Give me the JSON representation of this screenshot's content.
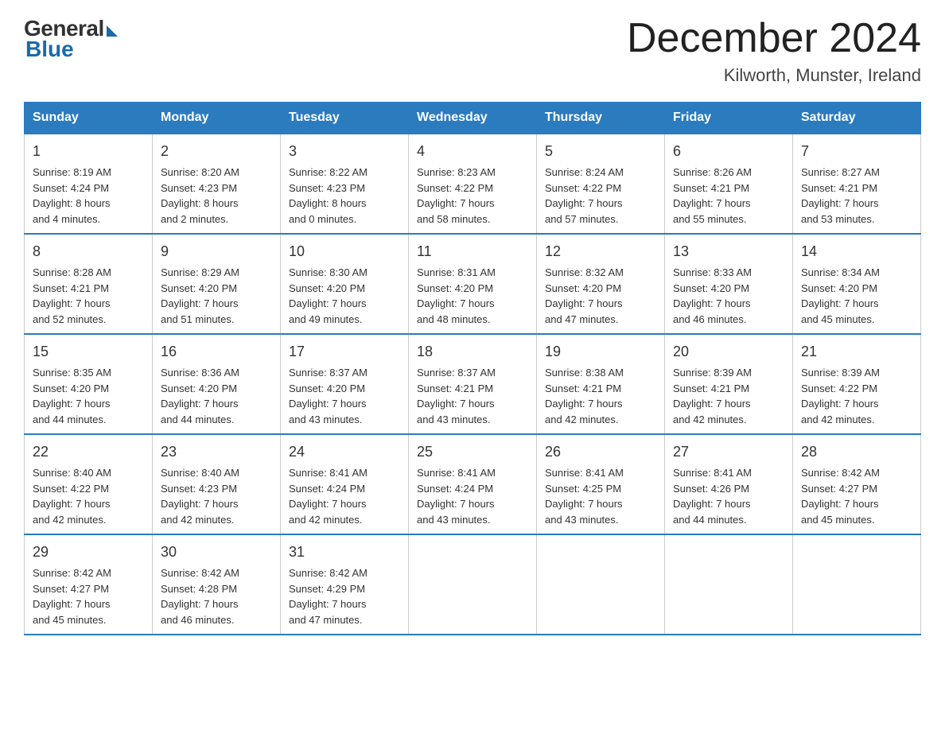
{
  "logo": {
    "general": "General",
    "blue": "Blue"
  },
  "header": {
    "month": "December 2024",
    "location": "Kilworth, Munster, Ireland"
  },
  "weekdays": [
    "Sunday",
    "Monday",
    "Tuesday",
    "Wednesday",
    "Thursday",
    "Friday",
    "Saturday"
  ],
  "weeks": [
    [
      {
        "day": "1",
        "info": "Sunrise: 8:19 AM\nSunset: 4:24 PM\nDaylight: 8 hours\nand 4 minutes."
      },
      {
        "day": "2",
        "info": "Sunrise: 8:20 AM\nSunset: 4:23 PM\nDaylight: 8 hours\nand 2 minutes."
      },
      {
        "day": "3",
        "info": "Sunrise: 8:22 AM\nSunset: 4:23 PM\nDaylight: 8 hours\nand 0 minutes."
      },
      {
        "day": "4",
        "info": "Sunrise: 8:23 AM\nSunset: 4:22 PM\nDaylight: 7 hours\nand 58 minutes."
      },
      {
        "day": "5",
        "info": "Sunrise: 8:24 AM\nSunset: 4:22 PM\nDaylight: 7 hours\nand 57 minutes."
      },
      {
        "day": "6",
        "info": "Sunrise: 8:26 AM\nSunset: 4:21 PM\nDaylight: 7 hours\nand 55 minutes."
      },
      {
        "day": "7",
        "info": "Sunrise: 8:27 AM\nSunset: 4:21 PM\nDaylight: 7 hours\nand 53 minutes."
      }
    ],
    [
      {
        "day": "8",
        "info": "Sunrise: 8:28 AM\nSunset: 4:21 PM\nDaylight: 7 hours\nand 52 minutes."
      },
      {
        "day": "9",
        "info": "Sunrise: 8:29 AM\nSunset: 4:20 PM\nDaylight: 7 hours\nand 51 minutes."
      },
      {
        "day": "10",
        "info": "Sunrise: 8:30 AM\nSunset: 4:20 PM\nDaylight: 7 hours\nand 49 minutes."
      },
      {
        "day": "11",
        "info": "Sunrise: 8:31 AM\nSunset: 4:20 PM\nDaylight: 7 hours\nand 48 minutes."
      },
      {
        "day": "12",
        "info": "Sunrise: 8:32 AM\nSunset: 4:20 PM\nDaylight: 7 hours\nand 47 minutes."
      },
      {
        "day": "13",
        "info": "Sunrise: 8:33 AM\nSunset: 4:20 PM\nDaylight: 7 hours\nand 46 minutes."
      },
      {
        "day": "14",
        "info": "Sunrise: 8:34 AM\nSunset: 4:20 PM\nDaylight: 7 hours\nand 45 minutes."
      }
    ],
    [
      {
        "day": "15",
        "info": "Sunrise: 8:35 AM\nSunset: 4:20 PM\nDaylight: 7 hours\nand 44 minutes."
      },
      {
        "day": "16",
        "info": "Sunrise: 8:36 AM\nSunset: 4:20 PM\nDaylight: 7 hours\nand 44 minutes."
      },
      {
        "day": "17",
        "info": "Sunrise: 8:37 AM\nSunset: 4:20 PM\nDaylight: 7 hours\nand 43 minutes."
      },
      {
        "day": "18",
        "info": "Sunrise: 8:37 AM\nSunset: 4:21 PM\nDaylight: 7 hours\nand 43 minutes."
      },
      {
        "day": "19",
        "info": "Sunrise: 8:38 AM\nSunset: 4:21 PM\nDaylight: 7 hours\nand 42 minutes."
      },
      {
        "day": "20",
        "info": "Sunrise: 8:39 AM\nSunset: 4:21 PM\nDaylight: 7 hours\nand 42 minutes."
      },
      {
        "day": "21",
        "info": "Sunrise: 8:39 AM\nSunset: 4:22 PM\nDaylight: 7 hours\nand 42 minutes."
      }
    ],
    [
      {
        "day": "22",
        "info": "Sunrise: 8:40 AM\nSunset: 4:22 PM\nDaylight: 7 hours\nand 42 minutes."
      },
      {
        "day": "23",
        "info": "Sunrise: 8:40 AM\nSunset: 4:23 PM\nDaylight: 7 hours\nand 42 minutes."
      },
      {
        "day": "24",
        "info": "Sunrise: 8:41 AM\nSunset: 4:24 PM\nDaylight: 7 hours\nand 42 minutes."
      },
      {
        "day": "25",
        "info": "Sunrise: 8:41 AM\nSunset: 4:24 PM\nDaylight: 7 hours\nand 43 minutes."
      },
      {
        "day": "26",
        "info": "Sunrise: 8:41 AM\nSunset: 4:25 PM\nDaylight: 7 hours\nand 43 minutes."
      },
      {
        "day": "27",
        "info": "Sunrise: 8:41 AM\nSunset: 4:26 PM\nDaylight: 7 hours\nand 44 minutes."
      },
      {
        "day": "28",
        "info": "Sunrise: 8:42 AM\nSunset: 4:27 PM\nDaylight: 7 hours\nand 45 minutes."
      }
    ],
    [
      {
        "day": "29",
        "info": "Sunrise: 8:42 AM\nSunset: 4:27 PM\nDaylight: 7 hours\nand 45 minutes."
      },
      {
        "day": "30",
        "info": "Sunrise: 8:42 AM\nSunset: 4:28 PM\nDaylight: 7 hours\nand 46 minutes."
      },
      {
        "day": "31",
        "info": "Sunrise: 8:42 AM\nSunset: 4:29 PM\nDaylight: 7 hours\nand 47 minutes."
      },
      {
        "day": "",
        "info": ""
      },
      {
        "day": "",
        "info": ""
      },
      {
        "day": "",
        "info": ""
      },
      {
        "day": "",
        "info": ""
      }
    ]
  ]
}
